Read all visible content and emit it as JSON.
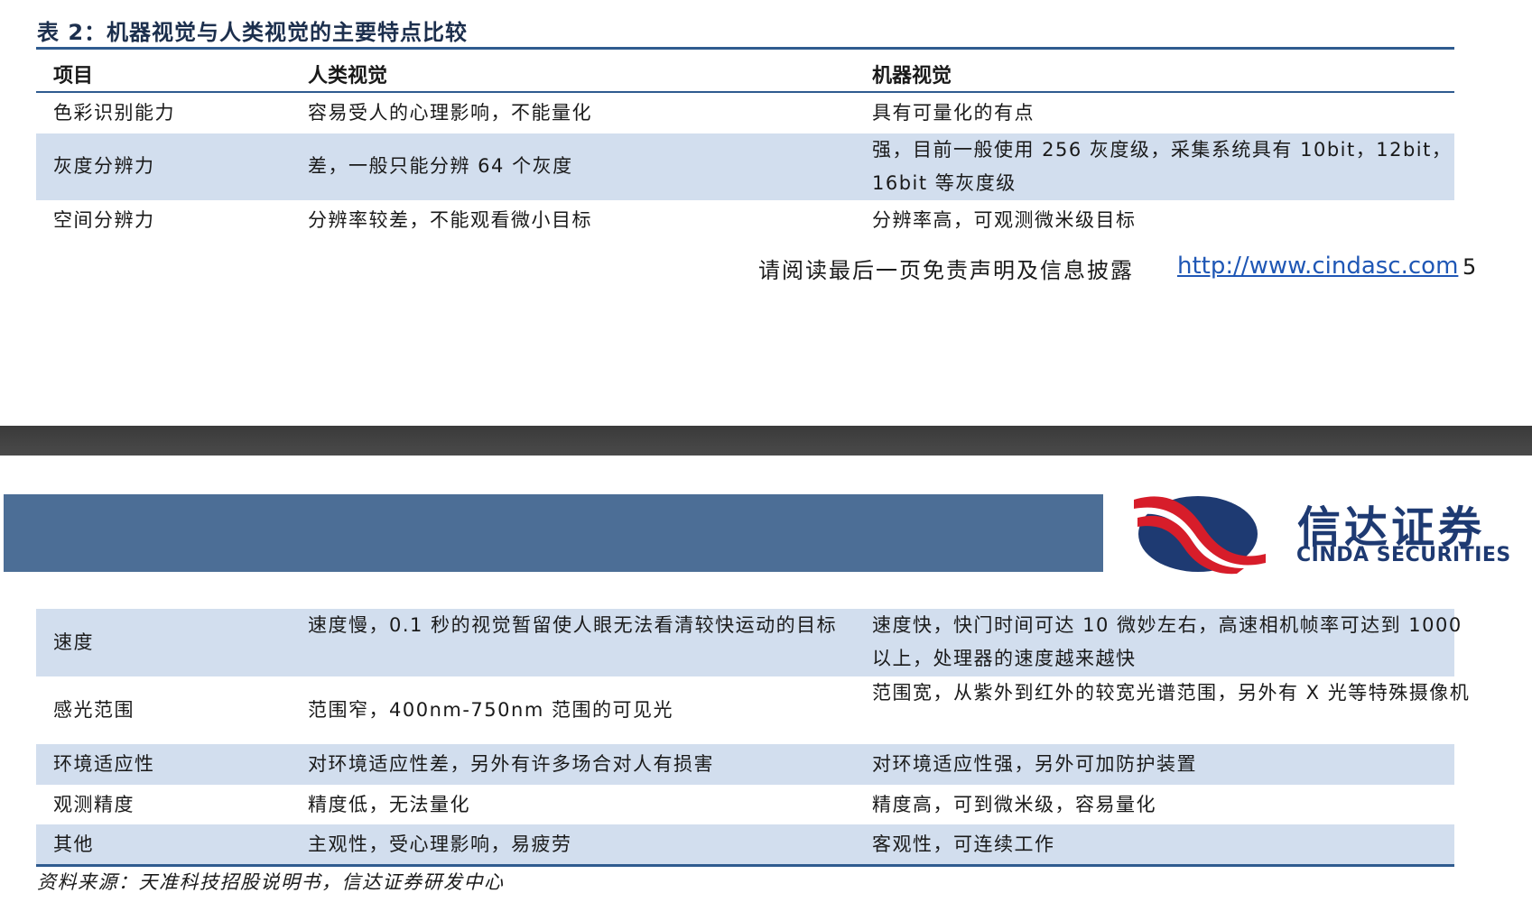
{
  "table": {
    "caption": "表 2：机器视觉与人类视觉的主要特点比较",
    "headers": [
      "项目",
      "人类视觉",
      "机器视觉"
    ],
    "rows_top": [
      [
        "色彩识别能力",
        "容易受人的心理影响，不能量化",
        "具有可量化的有点"
      ],
      [
        "灰度分辨力",
        "差，一般只能分辨 64 个灰度",
        "强，目前一般使用 256 灰度级，采集系统具有 10bit，12bit，16bit 等灰度级"
      ],
      [
        "空间分辨力",
        "分辨率较差，不能观看微小目标",
        "分辨率高，可观测微米级目标"
      ]
    ],
    "rows_bottom": [
      [
        "速度",
        "速度慢，0.1 秒的视觉暂留使人眼无法看清较快运动的目标",
        "速度快，快门时间可达 10 微妙左右，高速相机帧率可达到 1000 以上，处理器的速度越来越快"
      ],
      [
        "感光范围",
        "范围窄，400nm-750nm 范围的可见光",
        "范围宽，从紫外到红外的较宽光谱范围，另外有 X 光等特殊摄像机"
      ],
      [
        "环境适应性",
        "对环境适应性差，另外有许多场合对人有损害",
        "对环境适应性强，另外可加防护装置"
      ],
      [
        "观测精度",
        "精度低，无法量化",
        "精度高，可到微米级，容易量化"
      ],
      [
        "其他",
        "主观性，受心理影响，易疲劳",
        "客观性，可连续工作"
      ]
    ]
  },
  "footer": {
    "disclaimer": "请阅读最后一页免责声明及信息披露",
    "link": "http://www.cindasc.com",
    "page_number": "5"
  },
  "logo": {
    "name_cn": "信达证券",
    "name_en": "CINDA SECURITIES"
  },
  "source": "资料来源：天准科技招股说明书，信达证券研发中心",
  "colors": {
    "rule_blue": "#2f5b8f",
    "row_shade": "#d2deee",
    "band_blue": "#4c6e96",
    "logo_navy": "#1e3a72",
    "logo_red": "#d71d2a",
    "link_blue": "#1f57b5"
  }
}
